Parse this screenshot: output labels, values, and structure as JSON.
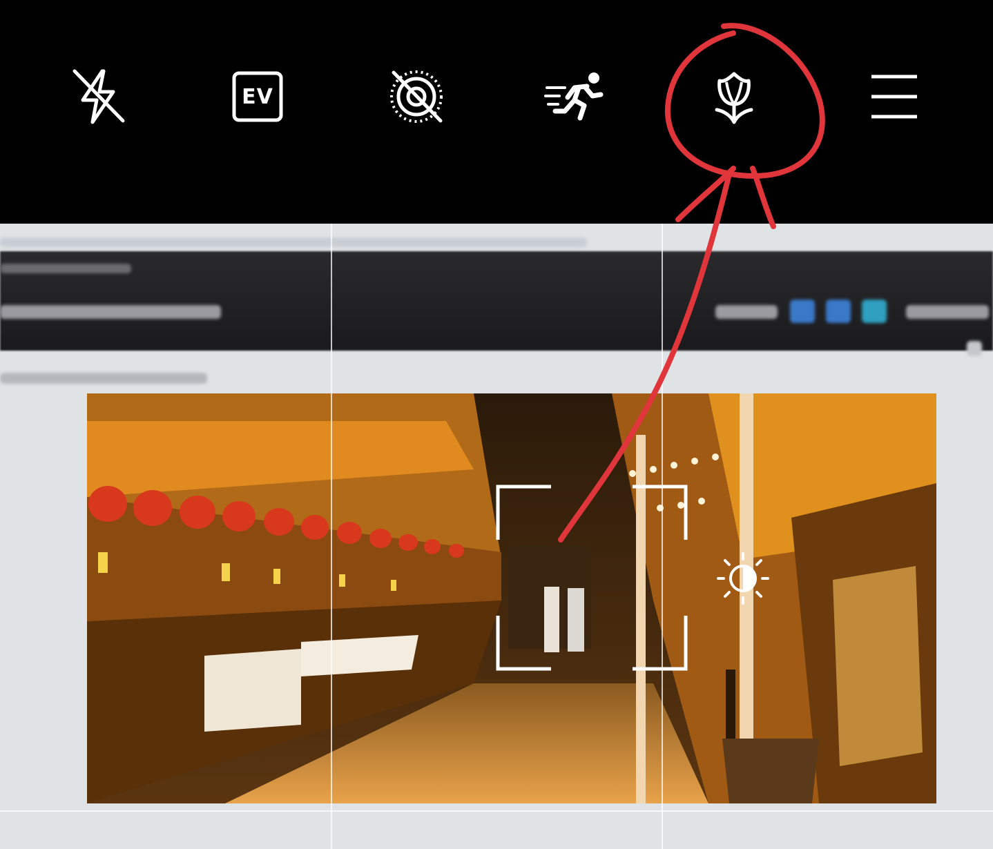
{
  "toolbar": {
    "buttons": [
      {
        "id": "flash",
        "icon": "flash-off-icon",
        "state": "off"
      },
      {
        "id": "ev",
        "icon": "ev-icon",
        "label": "EV"
      },
      {
        "id": "live",
        "icon": "live-photo-off-icon",
        "state": "off"
      },
      {
        "id": "motion",
        "icon": "motion-running-icon"
      },
      {
        "id": "filter",
        "icon": "tulip-flower-icon",
        "annotated": true
      },
      {
        "id": "menu",
        "icon": "hamburger-menu-icon"
      }
    ]
  },
  "viewfinder": {
    "grid": "3x3",
    "focus_indicator": "focus-bracket",
    "exposure_icon": "sun-exposure-icon"
  },
  "annotation": {
    "color": "#e0353b",
    "shape": "circle-with-arrow",
    "target": "filter"
  },
  "colors": {
    "background": "#000000",
    "icon": "#ffffff",
    "annotation_red": "#e0353b"
  }
}
